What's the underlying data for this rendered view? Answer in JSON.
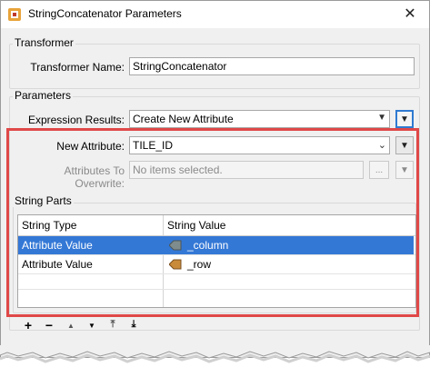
{
  "window": {
    "title": "StringConcatenator Parameters"
  },
  "transformer": {
    "group_label": "Transformer",
    "name_label": "Transformer Name:",
    "name_value": "StringConcatenator"
  },
  "parameters": {
    "group_label": "Parameters",
    "expression_results_label": "Expression Results:",
    "expression_results_value": "Create New Attribute",
    "new_attribute_label": "New Attribute:",
    "new_attribute_value": "TILE_ID",
    "overwrite_label": "Attributes To Overwrite:",
    "overwrite_placeholder": "No items selected.",
    "ellipsis": "..."
  },
  "string_parts": {
    "group_label": "String Parts",
    "columns": [
      "String Type",
      "String Value"
    ],
    "rows": [
      {
        "type": "Attribute Value",
        "value": "_column",
        "selected": true
      },
      {
        "type": "Attribute Value",
        "value": "_row",
        "selected": false
      }
    ]
  },
  "toolbar": {
    "add": "+",
    "remove": "−",
    "move_up": "▲",
    "move_down": "▼",
    "move_top": "⤒",
    "move_bottom": "⤓"
  },
  "colors": {
    "highlight_frame": "#e04848",
    "selection": "#3478d6",
    "focus": "#2f7ad1"
  }
}
